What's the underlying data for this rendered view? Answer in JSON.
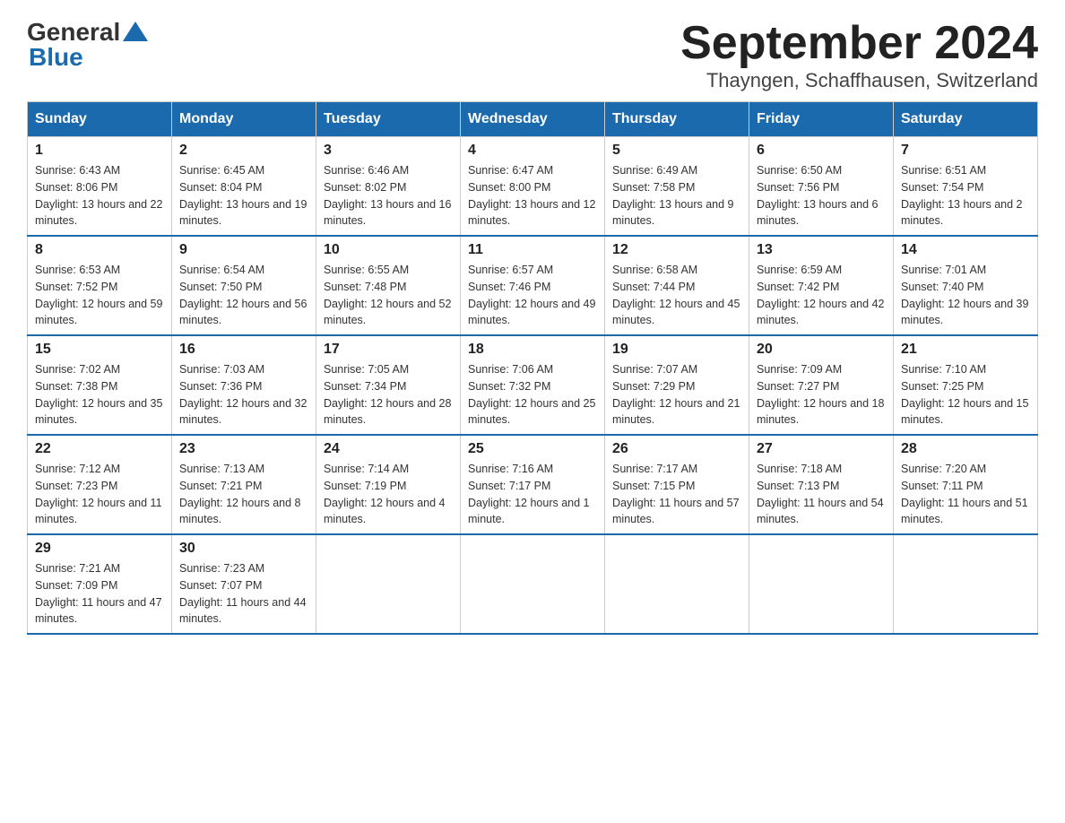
{
  "header": {
    "logo_general": "General",
    "logo_blue": "Blue",
    "title": "September 2024",
    "location": "Thayngen, Schaffhausen, Switzerland"
  },
  "weekdays": [
    "Sunday",
    "Monday",
    "Tuesday",
    "Wednesday",
    "Thursday",
    "Friday",
    "Saturday"
  ],
  "weeks": [
    [
      {
        "day": "1",
        "sunrise": "6:43 AM",
        "sunset": "8:06 PM",
        "daylight": "13 hours and 22 minutes."
      },
      {
        "day": "2",
        "sunrise": "6:45 AM",
        "sunset": "8:04 PM",
        "daylight": "13 hours and 19 minutes."
      },
      {
        "day": "3",
        "sunrise": "6:46 AM",
        "sunset": "8:02 PM",
        "daylight": "13 hours and 16 minutes."
      },
      {
        "day": "4",
        "sunrise": "6:47 AM",
        "sunset": "8:00 PM",
        "daylight": "13 hours and 12 minutes."
      },
      {
        "day": "5",
        "sunrise": "6:49 AM",
        "sunset": "7:58 PM",
        "daylight": "13 hours and 9 minutes."
      },
      {
        "day": "6",
        "sunrise": "6:50 AM",
        "sunset": "7:56 PM",
        "daylight": "13 hours and 6 minutes."
      },
      {
        "day": "7",
        "sunrise": "6:51 AM",
        "sunset": "7:54 PM",
        "daylight": "13 hours and 2 minutes."
      }
    ],
    [
      {
        "day": "8",
        "sunrise": "6:53 AM",
        "sunset": "7:52 PM",
        "daylight": "12 hours and 59 minutes."
      },
      {
        "day": "9",
        "sunrise": "6:54 AM",
        "sunset": "7:50 PM",
        "daylight": "12 hours and 56 minutes."
      },
      {
        "day": "10",
        "sunrise": "6:55 AM",
        "sunset": "7:48 PM",
        "daylight": "12 hours and 52 minutes."
      },
      {
        "day": "11",
        "sunrise": "6:57 AM",
        "sunset": "7:46 PM",
        "daylight": "12 hours and 49 minutes."
      },
      {
        "day": "12",
        "sunrise": "6:58 AM",
        "sunset": "7:44 PM",
        "daylight": "12 hours and 45 minutes."
      },
      {
        "day": "13",
        "sunrise": "6:59 AM",
        "sunset": "7:42 PM",
        "daylight": "12 hours and 42 minutes."
      },
      {
        "day": "14",
        "sunrise": "7:01 AM",
        "sunset": "7:40 PM",
        "daylight": "12 hours and 39 minutes."
      }
    ],
    [
      {
        "day": "15",
        "sunrise": "7:02 AM",
        "sunset": "7:38 PM",
        "daylight": "12 hours and 35 minutes."
      },
      {
        "day": "16",
        "sunrise": "7:03 AM",
        "sunset": "7:36 PM",
        "daylight": "12 hours and 32 minutes."
      },
      {
        "day": "17",
        "sunrise": "7:05 AM",
        "sunset": "7:34 PM",
        "daylight": "12 hours and 28 minutes."
      },
      {
        "day": "18",
        "sunrise": "7:06 AM",
        "sunset": "7:32 PM",
        "daylight": "12 hours and 25 minutes."
      },
      {
        "day": "19",
        "sunrise": "7:07 AM",
        "sunset": "7:29 PM",
        "daylight": "12 hours and 21 minutes."
      },
      {
        "day": "20",
        "sunrise": "7:09 AM",
        "sunset": "7:27 PM",
        "daylight": "12 hours and 18 minutes."
      },
      {
        "day": "21",
        "sunrise": "7:10 AM",
        "sunset": "7:25 PM",
        "daylight": "12 hours and 15 minutes."
      }
    ],
    [
      {
        "day": "22",
        "sunrise": "7:12 AM",
        "sunset": "7:23 PM",
        "daylight": "12 hours and 11 minutes."
      },
      {
        "day": "23",
        "sunrise": "7:13 AM",
        "sunset": "7:21 PM",
        "daylight": "12 hours and 8 minutes."
      },
      {
        "day": "24",
        "sunrise": "7:14 AM",
        "sunset": "7:19 PM",
        "daylight": "12 hours and 4 minutes."
      },
      {
        "day": "25",
        "sunrise": "7:16 AM",
        "sunset": "7:17 PM",
        "daylight": "12 hours and 1 minute."
      },
      {
        "day": "26",
        "sunrise": "7:17 AM",
        "sunset": "7:15 PM",
        "daylight": "11 hours and 57 minutes."
      },
      {
        "day": "27",
        "sunrise": "7:18 AM",
        "sunset": "7:13 PM",
        "daylight": "11 hours and 54 minutes."
      },
      {
        "day": "28",
        "sunrise": "7:20 AM",
        "sunset": "7:11 PM",
        "daylight": "11 hours and 51 minutes."
      }
    ],
    [
      {
        "day": "29",
        "sunrise": "7:21 AM",
        "sunset": "7:09 PM",
        "daylight": "11 hours and 47 minutes."
      },
      {
        "day": "30",
        "sunrise": "7:23 AM",
        "sunset": "7:07 PM",
        "daylight": "11 hours and 44 minutes."
      },
      null,
      null,
      null,
      null,
      null
    ]
  ],
  "labels": {
    "sunrise": "Sunrise:",
    "sunset": "Sunset:",
    "daylight": "Daylight:"
  }
}
